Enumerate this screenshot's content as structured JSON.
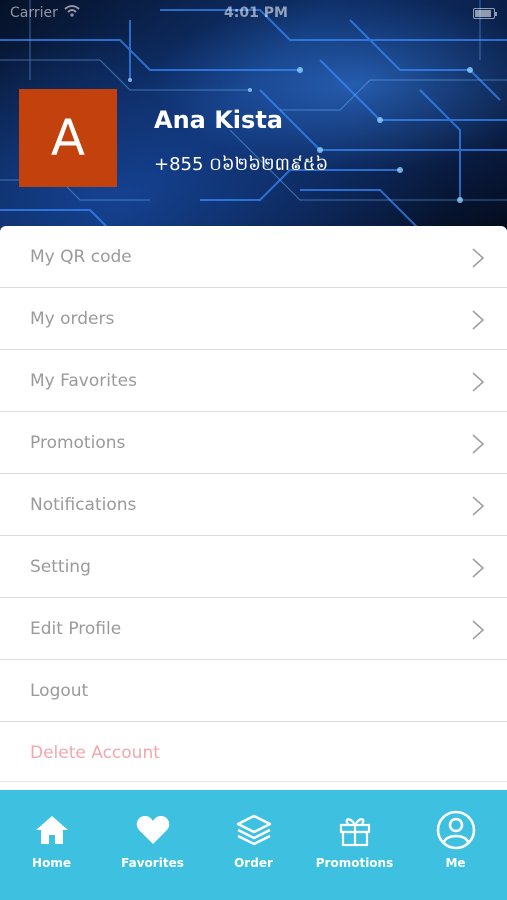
{
  "status_bar": {
    "carrier": "Carrier",
    "time": "4:01 PM"
  },
  "profile": {
    "avatar_initial": "A",
    "name": "Ana Kista",
    "phone": "+855 ០៦២៦២៣៩៥៦"
  },
  "menu": {
    "items": [
      {
        "label": "My QR code",
        "icon": "chevron-right-icon"
      },
      {
        "label": "My orders",
        "icon": "chevron-right-icon"
      },
      {
        "label": "My Favorites",
        "icon": "chevron-right-icon"
      },
      {
        "label": "Promotions",
        "icon": "chevron-right-icon"
      },
      {
        "label": "Notifications",
        "icon": "chevron-right-icon"
      },
      {
        "label": "Setting",
        "icon": "chevron-right-icon"
      },
      {
        "label": "Edit Profile",
        "icon": "chevron-right-icon"
      },
      {
        "label": "Logout"
      },
      {
        "label": "Delete Account"
      }
    ]
  },
  "tabbar": {
    "tabs": [
      {
        "label": "Home",
        "icon": "home-icon"
      },
      {
        "label": "Favorites",
        "icon": "heart-icon"
      },
      {
        "label": "Order",
        "icon": "layers-icon"
      },
      {
        "label": "Promotions",
        "icon": "gift-icon"
      },
      {
        "label": "Me",
        "icon": "user-circle-icon"
      }
    ],
    "active": "Me"
  },
  "colors": {
    "avatar_bg": "#c2410c",
    "tabbar_bg": "#3ec0e0",
    "menu_text": "#9a9a9a",
    "danger_text": "#f2a7ad"
  }
}
